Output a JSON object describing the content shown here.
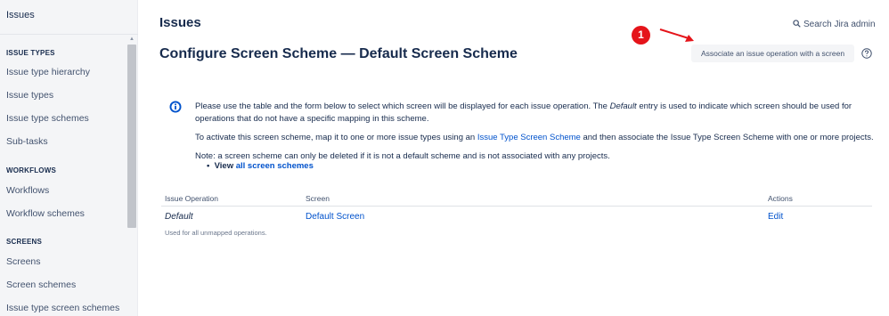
{
  "sidebar": {
    "top_label": "Issues",
    "sections": [
      {
        "heading": "ISSUE TYPES",
        "items": [
          "Issue type hierarchy",
          "Issue types",
          "Issue type schemes",
          "Sub-tasks"
        ]
      },
      {
        "heading": "WORKFLOWS",
        "items": [
          "Workflows",
          "Workflow schemes"
        ]
      },
      {
        "heading": "SCREENS",
        "items": [
          "Screens",
          "Screen schemes",
          "Issue type screen schemes"
        ]
      }
    ]
  },
  "header": {
    "category": "Issues",
    "search_label": "Search Jira admin",
    "title": "Configure Screen Scheme — Default Screen Scheme",
    "associate_button": "Associate an issue operation with a screen"
  },
  "callout": {
    "number": "1",
    "color": "#e5141a"
  },
  "info": {
    "para1_a": "Please use the table and the form below to select which screen will be displayed for each issue operation. The ",
    "para1_em": "Default",
    "para1_b": " entry is used to indicate which screen should be used for",
    "para1_line2": "operations that do not have a specific mapping in this scheme.",
    "para2_a": "To activate this screen scheme, map it to one or more issue types using an ",
    "para2_link": "Issue Type Screen Scheme",
    "para2_b": " and then associate the Issue Type Screen Scheme with one or more projects.",
    "note": "Note: a screen scheme can only be deleted if it is not a default scheme and is not associated with any projects.",
    "view_label": "View",
    "view_link": "all screen schemes"
  },
  "table": {
    "headers": [
      "Issue Operation",
      "Screen",
      "Actions"
    ],
    "rows": [
      {
        "operation": "Default",
        "note": "Used for all unmapped operations.",
        "screen": "Default Screen",
        "action": "Edit"
      }
    ]
  },
  "colors": {
    "link": "#0052cc",
    "text": "#172b4d",
    "sidebar_bg": "#f4f5f7"
  }
}
